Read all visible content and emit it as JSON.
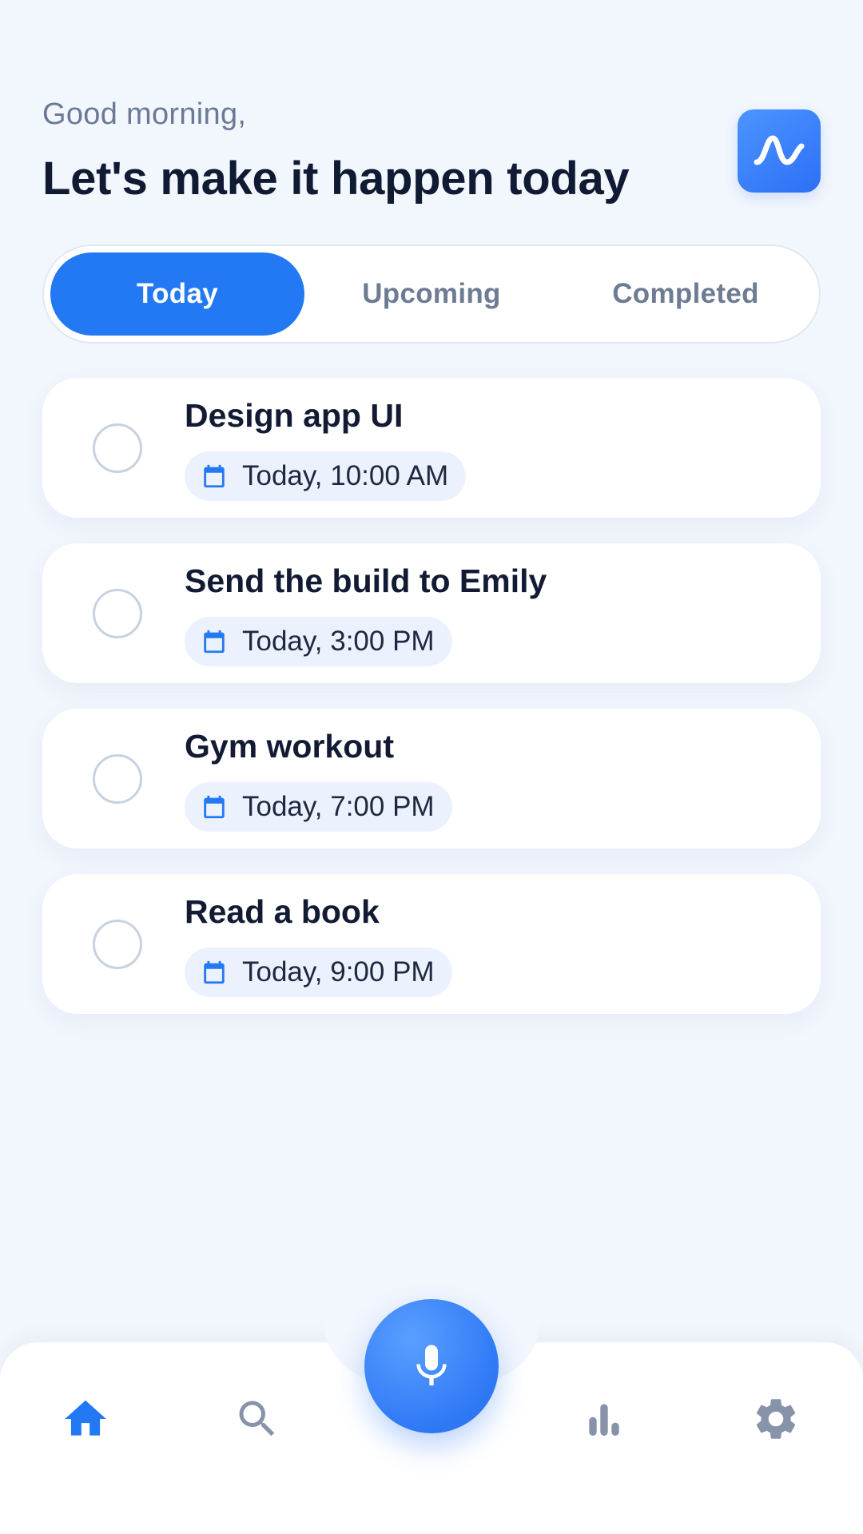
{
  "header": {
    "greeting": "Good morning,",
    "headline": "Let's make it happen today",
    "logo_icon": "wave-icon"
  },
  "tabs": [
    {
      "label": "Today",
      "active": true
    },
    {
      "label": "Upcoming",
      "active": false
    },
    {
      "label": "Completed",
      "active": false
    }
  ],
  "tasks": [
    {
      "title": "Design app UI",
      "due": "Today, 10:00 AM",
      "done": false
    },
    {
      "title": "Send the build to Emily",
      "due": "Today, 3:00 PM",
      "done": false
    },
    {
      "title": "Gym workout",
      "due": "Today, 7:00 PM",
      "done": false
    },
    {
      "title": "Read a book",
      "due": "Today, 9:00 PM",
      "done": false
    }
  ],
  "bottom_nav": {
    "items": [
      "home-icon",
      "search-icon",
      "microphone-icon",
      "bar-chart-icon",
      "gear-icon"
    ],
    "active": "home-icon"
  },
  "colors": {
    "accent": "#2379f4",
    "background": "#f2f6fd",
    "inactive_icon": "#8693a9",
    "text_primary": "#111a33",
    "text_secondary": "#6b7a94"
  }
}
